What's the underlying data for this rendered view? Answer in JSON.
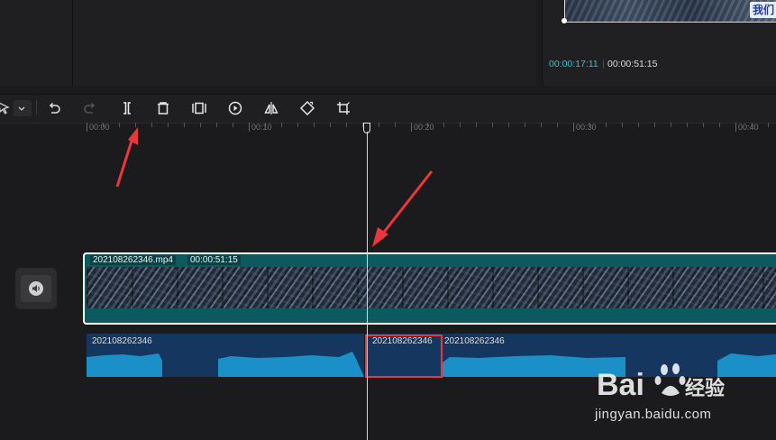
{
  "preview": {
    "badge_text": "我们",
    "time_current": "00:00:17:11",
    "time_separator": "|",
    "time_total": "00:00:51:15"
  },
  "toolbar": {
    "icons": [
      "select-arrow-icon",
      "dropdown-chevron-icon",
      "undo-icon",
      "redo-icon",
      "split-icon",
      "delete-icon",
      "freeze-frame-icon",
      "play-reverse-icon",
      "mirror-icon",
      "rotate-icon",
      "crop-icon"
    ]
  },
  "ruler": {
    "labels": [
      "00:00",
      "00:10",
      "00:20",
      "00:30",
      "00:40"
    ]
  },
  "video_track": {
    "clip_name": "202108262346.mp4",
    "clip_duration": "00:00:51:15"
  },
  "audio_track": {
    "clips": [
      {
        "label": "202108262346"
      },
      {
        "label": "202108262346"
      },
      {
        "label": "202108262346"
      }
    ]
  },
  "watermark": {
    "logo_text": "Bai du 经验",
    "url_text": "jingyan.baidu.com"
  },
  "colors": {
    "accent_time": "#2ec6d6",
    "video_clip": "#0c5a5e",
    "audio_clip": "#15365e",
    "waveform": "#1a8fc8",
    "annotation_red": "#e8383b"
  }
}
